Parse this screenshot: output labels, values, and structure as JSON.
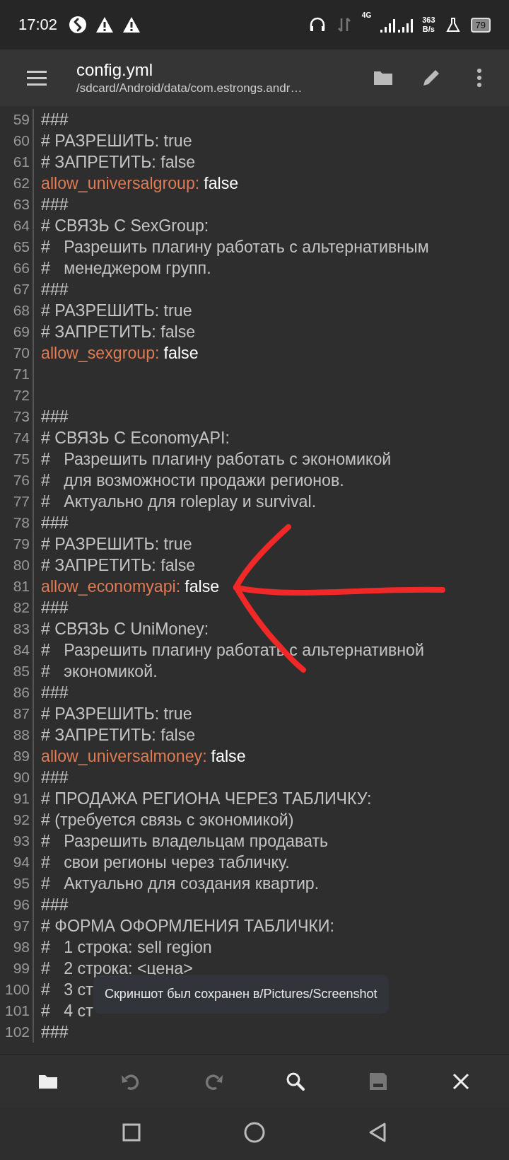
{
  "status_bar": {
    "time": "17:02",
    "network": "4G",
    "speed": [
      "363",
      "B/s"
    ],
    "battery": "79"
  },
  "app_bar": {
    "title": "config.yml",
    "path": "/sdcard/Android/data/com.estrongs.andr…"
  },
  "editor": {
    "lines": [
      {
        "number": "59",
        "kind": "comment",
        "text": "###"
      },
      {
        "number": "60",
        "kind": "comment",
        "text": "# РАЗРЕШИТЬ: true"
      },
      {
        "number": "61",
        "kind": "comment",
        "text": "# ЗАПРЕТИТЬ: false"
      },
      {
        "number": "62",
        "kind": "setting",
        "key": "allow_universalgroup:",
        "value": "false"
      },
      {
        "number": "63",
        "kind": "comment",
        "text": "###"
      },
      {
        "number": "64",
        "kind": "comment",
        "text": "# СВЯЗЬ С SexGroup:"
      },
      {
        "number": "65",
        "kind": "comment",
        "text": "#   Разрешить плагину работать с альтернативным"
      },
      {
        "number": "66",
        "kind": "comment",
        "text": "#   менеджером групп."
      },
      {
        "number": "67",
        "kind": "comment",
        "text": "###"
      },
      {
        "number": "68",
        "kind": "comment",
        "text": "# РАЗРЕШИТЬ: true"
      },
      {
        "number": "69",
        "kind": "comment",
        "text": "# ЗАПРЕТИТЬ: false"
      },
      {
        "number": "70",
        "kind": "setting",
        "key": "allow_sexgroup:",
        "value": "false"
      },
      {
        "number": "71",
        "kind": "blank"
      },
      {
        "number": "72",
        "kind": "blank"
      },
      {
        "number": "73",
        "kind": "comment",
        "text": "###"
      },
      {
        "number": "74",
        "kind": "comment",
        "text": "# СВЯЗЬ С EconomyAPI:"
      },
      {
        "number": "75",
        "kind": "comment",
        "text": "#   Разрешить плагину работать с экономикой"
      },
      {
        "number": "76",
        "kind": "comment",
        "text": "#   для возможности продажи регионов."
      },
      {
        "number": "77",
        "kind": "comment",
        "text": "#   Актуально для roleplay и survival."
      },
      {
        "number": "78",
        "kind": "comment",
        "text": "###"
      },
      {
        "number": "79",
        "kind": "comment",
        "text": "# РАЗРЕШИТЬ: true"
      },
      {
        "number": "80",
        "kind": "comment",
        "text": "# ЗАПРЕТИТЬ: false"
      },
      {
        "number": "81",
        "kind": "setting",
        "key": "allow_economyapi:",
        "value": "false"
      },
      {
        "number": "82",
        "kind": "comment",
        "text": "###"
      },
      {
        "number": "83",
        "kind": "comment",
        "text": "# СВЯЗЬ С UniMoney:"
      },
      {
        "number": "84",
        "kind": "comment",
        "text": "#   Разрешить плагину работать с альтернативной"
      },
      {
        "number": "85",
        "kind": "comment",
        "text": "#   экономикой."
      },
      {
        "number": "86",
        "kind": "comment",
        "text": "###"
      },
      {
        "number": "87",
        "kind": "comment",
        "text": "# РАЗРЕШИТЬ: true"
      },
      {
        "number": "88",
        "kind": "comment",
        "text": "# ЗАПРЕТИТЬ: false"
      },
      {
        "number": "89",
        "kind": "setting",
        "key": "allow_universalmoney:",
        "value": "false"
      },
      {
        "number": "90",
        "kind": "comment",
        "text": "###"
      },
      {
        "number": "91",
        "kind": "comment",
        "text": "# ПРОДАЖА РЕГИОНА ЧЕРЕЗ ТАБЛИЧКУ:"
      },
      {
        "number": "92",
        "kind": "comment",
        "text": "# (требуется связь с экономикой)"
      },
      {
        "number": "93",
        "kind": "comment",
        "text": "#   Разрешить владельцам продавать"
      },
      {
        "number": "94",
        "kind": "comment",
        "text": "#   свои регионы через табличку."
      },
      {
        "number": "95",
        "kind": "comment",
        "text": "#   Актуально для создания квартир."
      },
      {
        "number": "96",
        "kind": "comment",
        "text": "###"
      },
      {
        "number": "97",
        "kind": "comment",
        "text": "# ФОРМА ОФОРМЛЕНИЯ ТАБЛИЧКИ:"
      },
      {
        "number": "98",
        "kind": "comment",
        "text": "#   1 строка: sell region"
      },
      {
        "number": "99",
        "kind": "comment",
        "text": "#   2 строка: <цена>"
      },
      {
        "number": "100",
        "kind": "comment",
        "text": "#   3 ст"
      },
      {
        "number": "101",
        "kind": "comment",
        "text": "#   4 ст"
      },
      {
        "number": "102",
        "kind": "comment",
        "text": "###"
      }
    ]
  },
  "toast": "Скриншот был сохранен в/Pictures/Screenshot",
  "toolbar": [
    {
      "kind": "open",
      "disabled": false
    },
    {
      "kind": "undo",
      "disabled": true
    },
    {
      "kind": "redo",
      "disabled": true
    },
    {
      "kind": "search",
      "disabled": false
    },
    {
      "kind": "save",
      "disabled": true
    },
    {
      "kind": "close",
      "disabled": false
    }
  ]
}
